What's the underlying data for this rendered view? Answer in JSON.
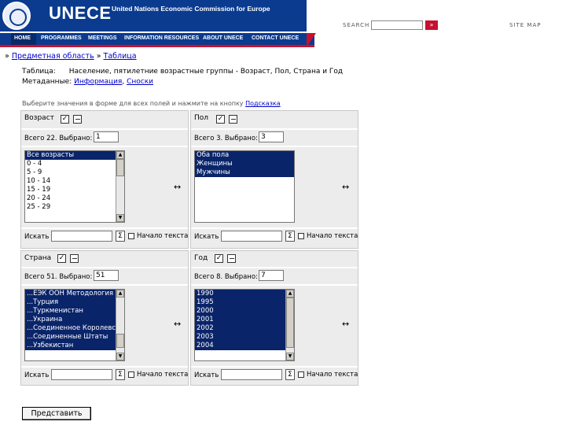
{
  "header": {
    "brand": "UNECE",
    "subtitle": "United Nations Economic Commission for Europe",
    "search_label": "SEARCH",
    "search_button": "»",
    "sitemap": "SITE MAP"
  },
  "nav": [
    "HOME",
    "PROGRAMMES",
    "MEETINGS",
    "INFORMATION RESOURCES",
    "ABOUT UNECE",
    "CONTACT UNECE"
  ],
  "breadcrumb": {
    "sep": "»",
    "subject": "Предметная область",
    "table": "Таблица"
  },
  "meta": {
    "table_label": "Таблица:",
    "table_value": "Население, пятилетние возрастные группы - Возраст, Пол, Страна и Год",
    "metadata_label": "Метаданные:",
    "info_link": "Информация",
    "notes_link": "Сноски"
  },
  "hint": {
    "text": "Выберите значения в форме для всех полей и нажмите на кнопку",
    "link": "Подсказка"
  },
  "dimensions": [
    {
      "title": "Возраст",
      "total_label": "Всего 22. Выбрано:",
      "selected": "1",
      "items": [
        "Все возрасты",
        "0 - 4",
        "5 - 9",
        "10 - 14",
        "15 - 19",
        "20 - 24",
        "25 - 29"
      ],
      "selected_items": [
        0
      ]
    },
    {
      "title": "Пол",
      "total_label": "Всего 3. Выбрано:",
      "selected": "3",
      "items": [
        "Оба пола",
        "Женщины",
        "Мужчины"
      ],
      "selected_items": [
        0,
        1,
        2
      ]
    },
    {
      "title": "Страна",
      "total_label": "Всего 51. Выбрано:",
      "selected": "51",
      "items": [
        "...ЕЭК ООН Методология",
        "...Турция",
        "...Туркменистан",
        "...Украина",
        "...Соединенное Королевство",
        "...Соединенные Штаты",
        "...Узбекистан"
      ],
      "selected_items": [
        0,
        1,
        2,
        3,
        4,
        5,
        6
      ]
    },
    {
      "title": "Год",
      "total_label": "Всего 8. Выбрано:",
      "selected": "7",
      "items": [
        "1990",
        "1995",
        "2000",
        "2001",
        "2002",
        "2003",
        "2004"
      ],
      "selected_items": [
        0,
        1,
        2,
        3,
        4,
        5,
        6
      ]
    }
  ],
  "controls": {
    "move_arrow": "↔",
    "search_label": "Искать",
    "go": "Σ",
    "start_text_label": "Начало текста",
    "check_mark": "✓"
  },
  "submit_label": "Представить"
}
